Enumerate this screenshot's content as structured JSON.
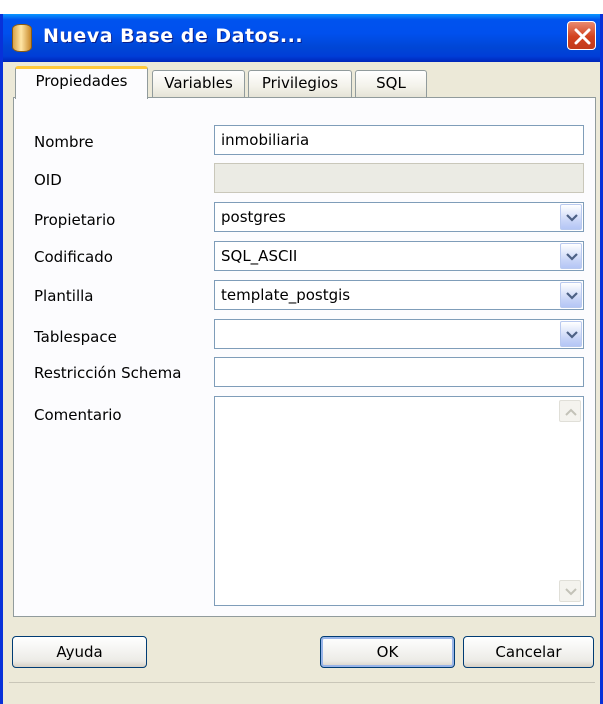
{
  "window": {
    "title": "Nueva Base de Datos..."
  },
  "tabs": [
    {
      "label": "Propiedades"
    },
    {
      "label": "Variables"
    },
    {
      "label": "Privilegios"
    },
    {
      "label": "SQL"
    }
  ],
  "form": {
    "nombre": {
      "label": "Nombre",
      "value": "inmobiliaria"
    },
    "oid": {
      "label": "OID",
      "value": ""
    },
    "propietario": {
      "label": "Propietario",
      "value": "postgres"
    },
    "codificado": {
      "label": "Codificado",
      "value": "SQL_ASCII"
    },
    "plantilla": {
      "label": "Plantilla",
      "value": "template_postgis"
    },
    "tablespace": {
      "label": "Tablespace",
      "value": ""
    },
    "restriccion": {
      "label": "Restricción Schema",
      "value": ""
    },
    "comentario": {
      "label": "Comentario",
      "value": ""
    }
  },
  "buttons": {
    "help": "Ayuda",
    "ok": "OK",
    "cancel": "Cancelar"
  },
  "icons": {
    "app": "database-icon",
    "close": "close-icon",
    "combo": "chevron-down-icon",
    "scroll_up": "arrow-up-icon",
    "scroll_down": "arrow-down-icon"
  },
  "colors": {
    "titlebar": "#0053ee",
    "window_bg": "#ece9d8",
    "close": "#d2421e",
    "active_tab_accent": "#ffc83c"
  }
}
